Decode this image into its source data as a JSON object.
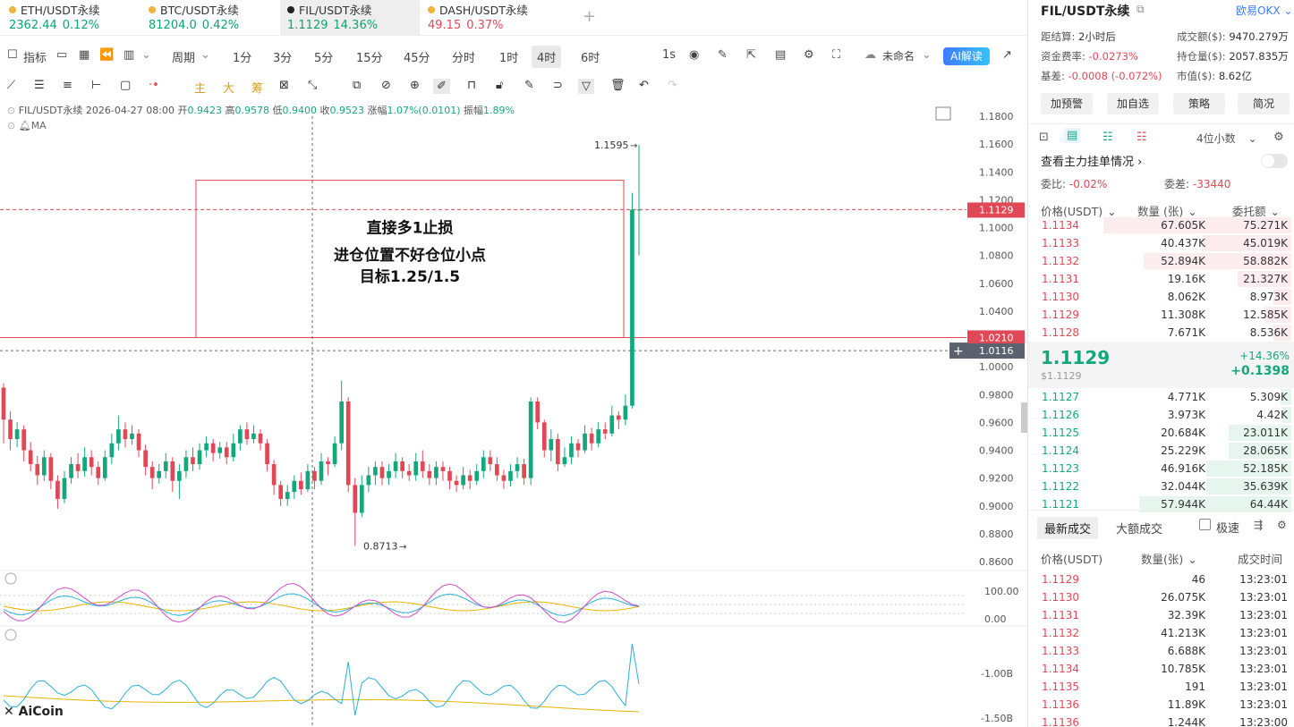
{
  "tabs": [
    {
      "name": "ETH/USDT永续",
      "price": "2362.44",
      "change": "0.12%",
      "dir": "up"
    },
    {
      "name": "BTC/USDT永续",
      "price": "81204.0",
      "change": "0.42%",
      "dir": "up"
    },
    {
      "name": "FIL/USDT永续",
      "price": "1.1129",
      "change": "14.36%",
      "dir": "up",
      "active": true
    },
    {
      "name": "DASH/USDT永续",
      "price": "49.15",
      "change": "0.37%",
      "dir": "dn"
    }
  ],
  "toolbar": {
    "indicator": "指标",
    "period": "周期",
    "intervals": [
      "1分",
      "3分",
      "5分",
      "15分",
      "45分",
      "分时",
      "1时",
      "4时",
      "6时"
    ],
    "selected_interval": "4时",
    "refresh": "1s",
    "template": "未命名",
    "ai": "AI解读"
  },
  "drawing_tools": {
    "main": "主",
    "big": "大",
    "chip": "筹"
  },
  "ohlc": {
    "symbol": "FIL/USDT永续",
    "datetime": "2026-04-27 08:00",
    "open_label": "开",
    "open": "0.9423",
    "high_label": "高",
    "high": "0.9578",
    "low_label": "低",
    "low": "0.9400",
    "close_label": "收",
    "close": "0.9523",
    "chg_label": "涨幅",
    "chg": "1.07%(0.0101)",
    "amp_label": "振幅",
    "amp": "1.89%"
  },
  "ma_label": "MA",
  "annotation": {
    "line1": "直接多1止损",
    "line2": "进仓位置不好仓位小点",
    "line3": "目标1.25/1.5"
  },
  "chart_data": {
    "type": "candlestick",
    "price_axis": [
      "1.1800",
      "1.1600",
      "1.1400",
      "1.1200",
      "1.1000",
      "1.0800",
      "1.0600",
      "1.0400",
      "1.0200",
      "1.0000",
      "0.9800",
      "0.9600",
      "0.9400",
      "0.9200",
      "0.9000",
      "0.8800",
      "0.8600"
    ],
    "ylim": [
      0.86,
      1.18
    ],
    "current_price_tag": "1.1129",
    "line_tag": "1.0210",
    "cursor_tag": "1.0116",
    "high_marker": "1.1595",
    "low_marker": "0.8713",
    "candles": [
      {
        "o": 0.985,
        "c": 0.962,
        "h": 0.988,
        "l": 0.945
      },
      {
        "o": 0.962,
        "c": 0.948,
        "h": 0.968,
        "l": 0.94
      },
      {
        "o": 0.948,
        "c": 0.955,
        "h": 0.96,
        "l": 0.942
      },
      {
        "o": 0.955,
        "c": 0.94,
        "h": 0.958,
        "l": 0.932
      },
      {
        "o": 0.94,
        "c": 0.93,
        "h": 0.946,
        "l": 0.925
      },
      {
        "o": 0.93,
        "c": 0.922,
        "h": 0.936,
        "l": 0.915
      },
      {
        "o": 0.922,
        "c": 0.935,
        "h": 0.94,
        "l": 0.918
      },
      {
        "o": 0.935,
        "c": 0.918,
        "h": 0.938,
        "l": 0.912
      },
      {
        "o": 0.918,
        "c": 0.905,
        "h": 0.922,
        "l": 0.898
      },
      {
        "o": 0.905,
        "c": 0.92,
        "h": 0.925,
        "l": 0.902
      },
      {
        "o": 0.92,
        "c": 0.93,
        "h": 0.935,
        "l": 0.916
      },
      {
        "o": 0.93,
        "c": 0.925,
        "h": 0.938,
        "l": 0.92
      },
      {
        "o": 0.925,
        "c": 0.935,
        "h": 0.942,
        "l": 0.921
      },
      {
        "o": 0.935,
        "c": 0.928,
        "h": 0.94,
        "l": 0.922
      },
      {
        "o": 0.928,
        "c": 0.92,
        "h": 0.932,
        "l": 0.915
      },
      {
        "o": 0.92,
        "c": 0.935,
        "h": 0.94,
        "l": 0.918
      },
      {
        "o": 0.935,
        "c": 0.945,
        "h": 0.952,
        "l": 0.93
      },
      {
        "o": 0.945,
        "c": 0.955,
        "h": 0.965,
        "l": 0.94
      },
      {
        "o": 0.955,
        "c": 0.948,
        "h": 0.96,
        "l": 0.942
      },
      {
        "o": 0.948,
        "c": 0.952,
        "h": 0.958,
        "l": 0.944
      },
      {
        "o": 0.952,
        "c": 0.94,
        "h": 0.955,
        "l": 0.935
      },
      {
        "o": 0.94,
        "c": 0.928,
        "h": 0.944,
        "l": 0.922
      },
      {
        "o": 0.928,
        "c": 0.92,
        "h": 0.932,
        "l": 0.912
      },
      {
        "o": 0.92,
        "c": 0.925,
        "h": 0.93,
        "l": 0.916
      },
      {
        "o": 0.925,
        "c": 0.932,
        "h": 0.938,
        "l": 0.92
      },
      {
        "o": 0.932,
        "c": 0.918,
        "h": 0.935,
        "l": 0.91
      },
      {
        "o": 0.918,
        "c": 0.925,
        "h": 0.93,
        "l": 0.905
      },
      {
        "o": 0.925,
        "c": 0.935,
        "h": 0.94,
        "l": 0.92
      },
      {
        "o": 0.935,
        "c": 0.93,
        "h": 0.942,
        "l": 0.925
      },
      {
        "o": 0.93,
        "c": 0.94,
        "h": 0.945,
        "l": 0.926
      },
      {
        "o": 0.94,
        "c": 0.945,
        "h": 0.95,
        "l": 0.935
      },
      {
        "o": 0.945,
        "c": 0.938,
        "h": 0.948,
        "l": 0.932
      },
      {
        "o": 0.938,
        "c": 0.942,
        "h": 0.946,
        "l": 0.934
      },
      {
        "o": 0.942,
        "c": 0.935,
        "h": 0.946,
        "l": 0.93
      },
      {
        "o": 0.935,
        "c": 0.945,
        "h": 0.952,
        "l": 0.932
      },
      {
        "o": 0.945,
        "c": 0.955,
        "h": 0.958,
        "l": 0.94
      },
      {
        "o": 0.955,
        "c": 0.948,
        "h": 0.96,
        "l": 0.944
      },
      {
        "o": 0.948,
        "c": 0.952,
        "h": 0.958,
        "l": 0.945
      },
      {
        "o": 0.952,
        "c": 0.945,
        "h": 0.955,
        "l": 0.94
      },
      {
        "o": 0.945,
        "c": 0.93,
        "h": 0.948,
        "l": 0.925
      },
      {
        "o": 0.93,
        "c": 0.915,
        "h": 0.933,
        "l": 0.908
      },
      {
        "o": 0.915,
        "c": 0.905,
        "h": 0.918,
        "l": 0.9
      },
      {
        "o": 0.905,
        "c": 0.91,
        "h": 0.915,
        "l": 0.9
      },
      {
        "o": 0.91,
        "c": 0.918,
        "h": 0.922,
        "l": 0.905
      },
      {
        "o": 0.918,
        "c": 0.912,
        "h": 0.924,
        "l": 0.908
      },
      {
        "o": 0.912,
        "c": 0.925,
        "h": 0.93,
        "l": 0.91
      },
      {
        "o": 0.925,
        "c": 0.918,
        "h": 0.928,
        "l": 0.912
      },
      {
        "o": 0.918,
        "c": 0.932,
        "h": 0.938,
        "l": 0.915
      },
      {
        "o": 0.932,
        "c": 0.93,
        "h": 0.935,
        "l": 0.922
      },
      {
        "o": 0.93,
        "c": 0.945,
        "h": 0.95,
        "l": 0.928
      },
      {
        "o": 0.945,
        "c": 0.975,
        "h": 0.99,
        "l": 0.94
      },
      {
        "o": 0.975,
        "c": 0.915,
        "h": 0.978,
        "l": 0.91
      },
      {
        "o": 0.915,
        "c": 0.895,
        "h": 0.92,
        "l": 0.8713
      },
      {
        "o": 0.895,
        "c": 0.915,
        "h": 0.922,
        "l": 0.892
      },
      {
        "o": 0.915,
        "c": 0.922,
        "h": 0.928,
        "l": 0.91
      },
      {
        "o": 0.922,
        "c": 0.928,
        "h": 0.932,
        "l": 0.915
      },
      {
        "o": 0.928,
        "c": 0.92,
        "h": 0.932,
        "l": 0.915
      },
      {
        "o": 0.92,
        "c": 0.925,
        "h": 0.93,
        "l": 0.915
      },
      {
        "o": 0.925,
        "c": 0.932,
        "h": 0.938,
        "l": 0.92
      },
      {
        "o": 0.932,
        "c": 0.925,
        "h": 0.935,
        "l": 0.92
      },
      {
        "o": 0.925,
        "c": 0.922,
        "h": 0.93,
        "l": 0.918
      },
      {
        "o": 0.922,
        "c": 0.932,
        "h": 0.938,
        "l": 0.918
      },
      {
        "o": 0.932,
        "c": 0.925,
        "h": 0.94,
        "l": 0.92
      },
      {
        "o": 0.925,
        "c": 0.92,
        "h": 0.93,
        "l": 0.915
      },
      {
        "o": 0.92,
        "c": 0.928,
        "h": 0.932,
        "l": 0.915
      },
      {
        "o": 0.928,
        "c": 0.925,
        "h": 0.932,
        "l": 0.918
      },
      {
        "o": 0.925,
        "c": 0.918,
        "h": 0.928,
        "l": 0.912
      },
      {
        "o": 0.918,
        "c": 0.915,
        "h": 0.922,
        "l": 0.91
      },
      {
        "o": 0.915,
        "c": 0.922,
        "h": 0.928,
        "l": 0.912
      },
      {
        "o": 0.922,
        "c": 0.918,
        "h": 0.926,
        "l": 0.912
      },
      {
        "o": 0.918,
        "c": 0.925,
        "h": 0.93,
        "l": 0.915
      },
      {
        "o": 0.925,
        "c": 0.935,
        "h": 0.94,
        "l": 0.92
      },
      {
        "o": 0.935,
        "c": 0.93,
        "h": 0.94,
        "l": 0.925
      },
      {
        "o": 0.93,
        "c": 0.922,
        "h": 0.935,
        "l": 0.918
      },
      {
        "o": 0.922,
        "c": 0.918,
        "h": 0.926,
        "l": 0.912
      },
      {
        "o": 0.918,
        "c": 0.925,
        "h": 0.93,
        "l": 0.914
      },
      {
        "o": 0.925,
        "c": 0.93,
        "h": 0.935,
        "l": 0.92
      },
      {
        "o": 0.93,
        "c": 0.92,
        "h": 0.934,
        "l": 0.915
      },
      {
        "o": 0.92,
        "c": 0.975,
        "h": 0.978,
        "l": 0.915
      },
      {
        "o": 0.975,
        "c": 0.96,
        "h": 0.978,
        "l": 0.955
      },
      {
        "o": 0.96,
        "c": 0.94,
        "h": 0.962,
        "l": 0.935
      },
      {
        "o": 0.94,
        "c": 0.948,
        "h": 0.955,
        "l": 0.932
      },
      {
        "o": 0.948,
        "c": 0.93,
        "h": 0.952,
        "l": 0.925
      },
      {
        "o": 0.93,
        "c": 0.935,
        "h": 0.942,
        "l": 0.928
      },
      {
        "o": 0.935,
        "c": 0.945,
        "h": 0.95,
        "l": 0.93
      },
      {
        "o": 0.945,
        "c": 0.94,
        "h": 0.948,
        "l": 0.935
      },
      {
        "o": 0.94,
        "c": 0.952,
        "h": 0.958,
        "l": 0.938
      },
      {
        "o": 0.952,
        "c": 0.945,
        "h": 0.956,
        "l": 0.94
      },
      {
        "o": 0.945,
        "c": 0.955,
        "h": 0.96,
        "l": 0.942
      },
      {
        "o": 0.955,
        "c": 0.952,
        "h": 0.96,
        "l": 0.948
      },
      {
        "o": 0.952,
        "c": 0.965,
        "h": 0.972,
        "l": 0.95
      },
      {
        "o": 0.965,
        "c": 0.962,
        "h": 0.968,
        "l": 0.955
      },
      {
        "o": 0.962,
        "c": 0.972,
        "h": 0.98,
        "l": 0.958
      },
      {
        "o": 0.972,
        "c": 1.1129,
        "h": 1.125,
        "l": 0.97
      },
      {
        "o": 1.1129,
        "c": 1.1129,
        "h": 1.1595,
        "l": 1.08
      }
    ],
    "rect_box": {
      "price_top": 1.134,
      "price_bottom": 1.021
    },
    "osc_axis": [
      "100.00",
      "0.00"
    ],
    "vol_axis": [
      "-1.00B",
      "-1.50B"
    ]
  },
  "right": {
    "symbol": "FIL/USDT永续",
    "exchange": "欧易OKX",
    "settle_label": "距结算:",
    "settle_val": "2小时后",
    "turnover_label": "成交额($):",
    "turnover_val": "9470.279万",
    "funding_label": "资金费率:",
    "funding_val": "-0.0273%",
    "oi_label": "持仓量($):",
    "oi_val": "2057.835万",
    "basis_label": "基差:",
    "basis_val": "-0.0008 (-0.072%)",
    "mcap_label": "市值($):",
    "mcap_val": "8.62亿",
    "buttons": [
      "加预警",
      "加自选",
      "策略",
      "简况"
    ],
    "decimals": "4位小数",
    "orderbook_title": "查看主力挂单情况",
    "ratio_label": "委比:",
    "ratio_val": "-0.02%",
    "diff_label": "委差:",
    "diff_val": "-33440",
    "ob_headers": [
      "价格(USDT)",
      "数量 (张)",
      "委托额"
    ],
    "asks": [
      {
        "p": "1.1134",
        "q": "67.605K",
        "t": "75.271K",
        "w": 210
      },
      {
        "p": "1.1133",
        "q": "40.437K",
        "t": "45.019K",
        "w": 100
      },
      {
        "p": "1.1132",
        "q": "52.894K",
        "t": "58.882K",
        "w": 165
      },
      {
        "p": "1.1131",
        "q": "19.16K",
        "t": "21.327K",
        "w": 60
      },
      {
        "p": "1.1130",
        "q": "8.062K",
        "t": "8.973K",
        "w": 20
      },
      {
        "p": "1.1129",
        "q": "11.308K",
        "t": "12.585K",
        "w": 30
      },
      {
        "p": "1.1128",
        "q": "7.671K",
        "t": "8.536K",
        "w": 20
      }
    ],
    "mid_price": "1.1129",
    "mid_usd": "$1.1129",
    "mid_pct": "+14.36%",
    "mid_abs": "+0.1398",
    "bids": [
      {
        "p": "1.1127",
        "q": "4.771K",
        "t": "5.309K",
        "w": 12
      },
      {
        "p": "1.1126",
        "q": "3.973K",
        "t": "4.42K",
        "w": 10
      },
      {
        "p": "1.1125",
        "q": "20.684K",
        "t": "23.011K",
        "w": 70
      },
      {
        "p": "1.1124",
        "q": "25.229K",
        "t": "28.065K",
        "w": 70
      },
      {
        "p": "1.1123",
        "q": "46.916K",
        "t": "52.185K",
        "w": 95
      },
      {
        "p": "1.1122",
        "q": "32.044K",
        "t": "35.639K",
        "w": 95
      },
      {
        "p": "1.1121",
        "q": "57.944K",
        "t": "64.44K",
        "w": 170
      }
    ],
    "trades_tab1": "最新成交",
    "trades_tab2": "大额成交",
    "fast_label": "极速",
    "tr_headers": [
      "价格(USDT)",
      "数量(张)",
      "成交时间"
    ],
    "trades": [
      {
        "p": "1.1129",
        "q": "46",
        "t": "13:23:01"
      },
      {
        "p": "1.1130",
        "q": "26.075K",
        "t": "13:23:01"
      },
      {
        "p": "1.1131",
        "q": "32.39K",
        "t": "13:23:01"
      },
      {
        "p": "1.1132",
        "q": "41.213K",
        "t": "13:23:01"
      },
      {
        "p": "1.1133",
        "q": "6.688K",
        "t": "13:23:01"
      },
      {
        "p": "1.1134",
        "q": "10.785K",
        "t": "13:23:01"
      },
      {
        "p": "1.1135",
        "q": "191",
        "t": "13:23:01"
      },
      {
        "p": "1.1136",
        "q": "11.89K",
        "t": "13:23:01"
      },
      {
        "p": "1.1136",
        "q": "1.244K",
        "t": "13:23:00"
      }
    ]
  },
  "brand": "AiCoin",
  "colors": {
    "up": "#13a87b",
    "down": "#e14856",
    "accent": "#3f7bff"
  }
}
